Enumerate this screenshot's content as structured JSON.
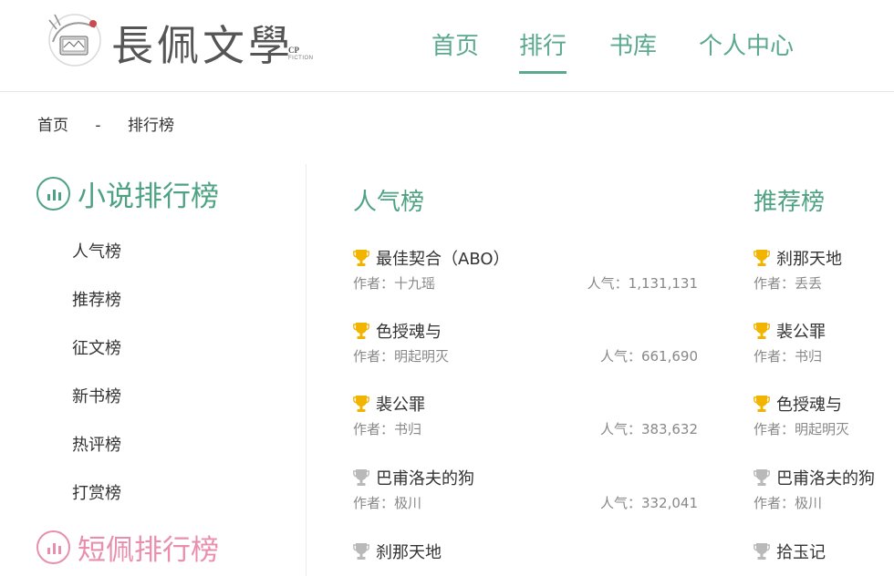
{
  "logo": {
    "title": "長佩文學",
    "cp": "CP",
    "fiction": "FICTION"
  },
  "nav": {
    "home": "首页",
    "rank": "排行",
    "library": "书库",
    "user": "个人中心",
    "active": "rank",
    "accent_color": "#5aa88e"
  },
  "breadcrumb": {
    "home": "首页",
    "separator": "-",
    "current": "排行榜"
  },
  "sidebar": {
    "novel_heading": "小说排行榜",
    "novel_color": "#4ea283",
    "items": [
      "人气榜",
      "推荐榜",
      "征文榜",
      "新书榜",
      "热评榜",
      "打赏榜"
    ],
    "short_heading": "短佩排行榜",
    "short_color": "#e88fae"
  },
  "popular": {
    "title": "人气榜",
    "entries": [
      {
        "title": "最佳契合（ABO）",
        "author": "作者：十九瑶",
        "popularity": "人气：1,131,131",
        "trophy": "gold"
      },
      {
        "title": "色授魂与",
        "author": "作者：明起明灭",
        "popularity": "人气：661,690",
        "trophy": "gold"
      },
      {
        "title": "裴公罪",
        "author": "作者：书归",
        "popularity": "人气：383,632",
        "trophy": "gold"
      },
      {
        "title": "巴甫洛夫的狗",
        "author": "作者：极川",
        "popularity": "人气：332,041",
        "trophy": "silver"
      },
      {
        "title": "刹那天地",
        "author": "",
        "popularity": "",
        "trophy": "silver"
      }
    ]
  },
  "recommend": {
    "title": "推荐榜",
    "entries": [
      {
        "title": "刹那天地",
        "author": "作者：丢丢",
        "trophy": "gold"
      },
      {
        "title": "裴公罪",
        "author": "作者：书归",
        "trophy": "gold"
      },
      {
        "title": "色授魂与",
        "author": "作者：明起明灭",
        "trophy": "gold"
      },
      {
        "title": "巴甫洛夫的狗",
        "author": "作者：极川",
        "trophy": "silver"
      },
      {
        "title": "拾玉记",
        "author": "",
        "trophy": "silver"
      }
    ]
  },
  "colors": {
    "gold": "#f2b400",
    "silver": "#b9b9b9"
  }
}
